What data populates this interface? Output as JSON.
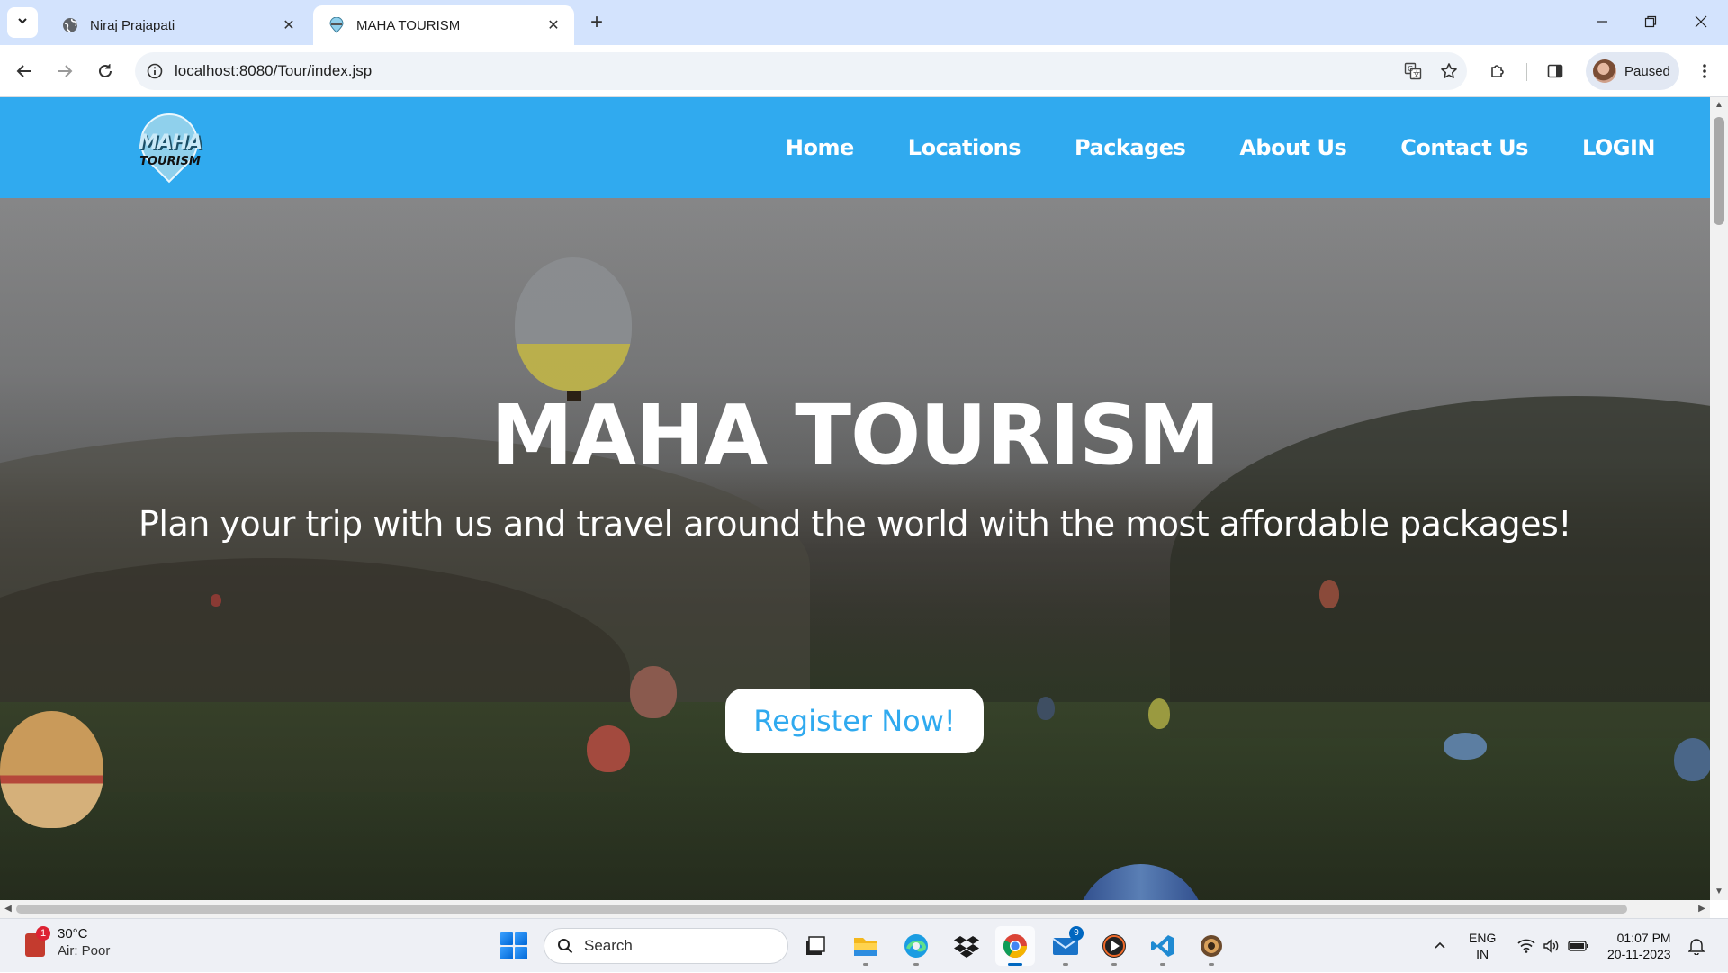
{
  "browser": {
    "tabs": [
      {
        "title": "Niraj Prajapati",
        "active": false,
        "icon": "globe-icon"
      },
      {
        "title": "MAHA TOURISM",
        "active": true,
        "icon": "site-favicon"
      }
    ],
    "url": "localhost:8080/Tour/index.jsp",
    "profile_label": "Paused"
  },
  "site": {
    "logo": {
      "line1": "MAHA",
      "line2": "TOURISM"
    },
    "nav": [
      "Home",
      "Locations",
      "Packages",
      "About Us",
      "Contact Us",
      "LOGIN"
    ],
    "hero": {
      "title": "MAHA TOURISM",
      "subtitle": "Plan your trip with us and travel around the world with the most affordable packages!",
      "cta": "Register Now!"
    },
    "accent_color": "#30aaef"
  },
  "taskbar": {
    "weather": {
      "temp": "30°C",
      "status": "Air: Poor",
      "badge": "1"
    },
    "search_placeholder": "Search",
    "mail_badge": "9",
    "language": {
      "line1": "ENG",
      "line2": "IN"
    },
    "time": "01:07 PM",
    "date": "20-11-2023"
  }
}
